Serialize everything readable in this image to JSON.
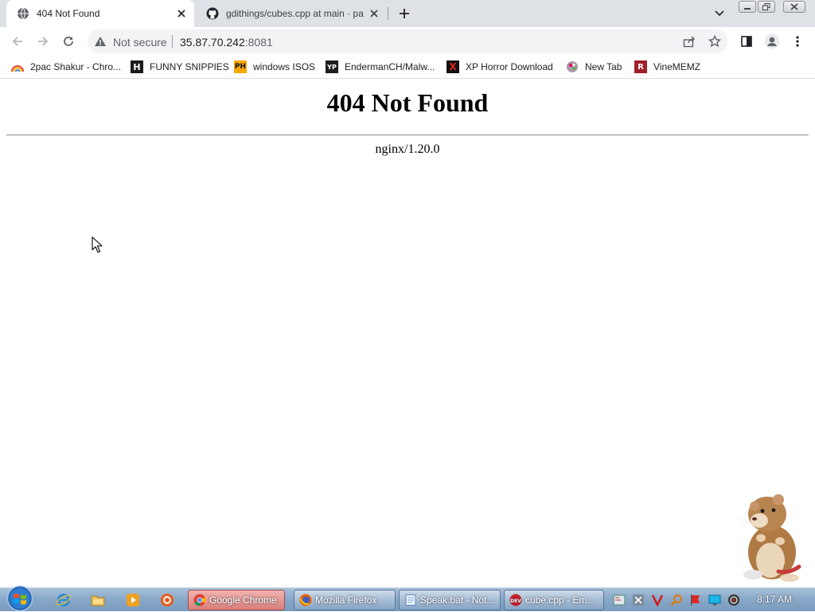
{
  "tabs": [
    {
      "title": "404 Not Found",
      "active": true,
      "favicon": "globe-icon"
    },
    {
      "title": "gdithings/cubes.cpp at main · pa",
      "active": false,
      "favicon": "github-icon"
    }
  ],
  "toolbar": {
    "security_label": "Not secure",
    "url_host": "35.87.70.242",
    "url_port": ":8081"
  },
  "bookmarks": [
    {
      "label": "2pac Shakur - Chro...",
      "icon": "rainbow-icon"
    },
    {
      "label": "FUNNY SNIPPIES",
      "icon": "h-icon",
      "icon_text": "H"
    },
    {
      "label": "windows ISOS",
      "icon": "ph-icon",
      "icon_text": "PH"
    },
    {
      "label": "EndermanCH/Malw...",
      "icon": "yp-icon",
      "icon_text": "YP"
    },
    {
      "label": "XP Horror Download",
      "icon": "x-icon",
      "icon_text": "X"
    },
    {
      "label": "New Tab",
      "icon": "newtab-icon"
    },
    {
      "label": "VineMEMZ",
      "icon": "vine-icon",
      "icon_text": "R"
    }
  ],
  "page": {
    "heading": "404 Not Found",
    "server": "nginx/1.20.0"
  },
  "taskbar": {
    "tasks": [
      {
        "label": "Google Chrome",
        "icon": "chrome-icon",
        "active": true
      },
      {
        "label": "Mozilla Firefox",
        "icon": "firefox-icon",
        "active": false
      },
      {
        "label": "Speak.bat - Not...",
        "icon": "notepad-icon",
        "active": false
      },
      {
        "label": "cube.cpp - Em...",
        "icon": "devcpp-icon",
        "active": false
      }
    ],
    "clock": "8:17 AM"
  },
  "colors": {
    "tabstrip": "#dee1e6",
    "omnibox": "#f1f3f4",
    "taskbar": "#8aa9c9",
    "active_task": "#d97f7b"
  }
}
